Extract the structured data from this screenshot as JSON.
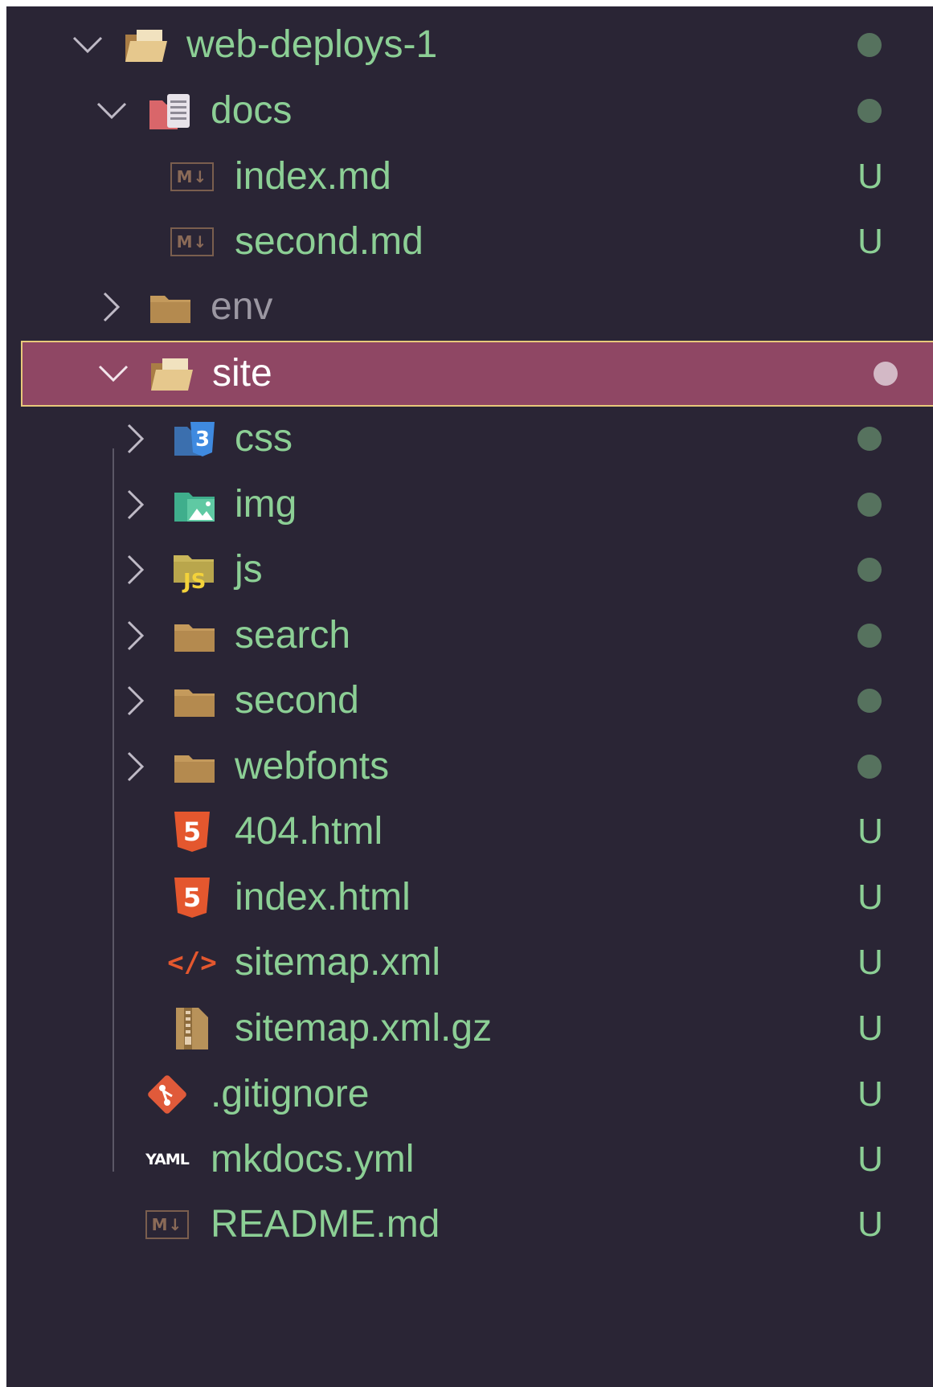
{
  "tree": {
    "root": {
      "label": "web-deploys-1",
      "icon": "folder-open-icon",
      "status": "dot"
    },
    "docs": {
      "label": "docs",
      "icon": "docs-folder-icon",
      "status": "dot"
    },
    "docs_index": {
      "label": "index.md",
      "icon": "markdown-icon",
      "status": "U"
    },
    "docs_second": {
      "label": "second.md",
      "icon": "markdown-icon",
      "status": "U"
    },
    "env": {
      "label": "env",
      "icon": "folder-icon",
      "status": ""
    },
    "site": {
      "label": "site",
      "icon": "folder-open-icon",
      "status": "dot",
      "selected": true
    },
    "css": {
      "label": "css",
      "icon": "css-folder-icon",
      "status": "dot"
    },
    "img": {
      "label": "img",
      "icon": "image-folder-icon",
      "status": "dot"
    },
    "js": {
      "label": "js",
      "icon": "js-folder-icon",
      "status": "dot",
      "badge": "JS"
    },
    "search": {
      "label": "search",
      "icon": "folder-icon",
      "status": "dot"
    },
    "second": {
      "label": "second",
      "icon": "folder-icon",
      "status": "dot"
    },
    "webfonts": {
      "label": "webfonts",
      "icon": "folder-icon",
      "status": "dot"
    },
    "html404": {
      "label": "404.html",
      "icon": "html5-icon",
      "status": "U"
    },
    "index_html": {
      "label": "index.html",
      "icon": "html5-icon",
      "status": "U"
    },
    "sitemap_xml": {
      "label": "sitemap.xml",
      "icon": "xml-icon",
      "status": "U"
    },
    "sitemap_gz": {
      "label": "sitemap.xml.gz",
      "icon": "zip-icon",
      "status": "U"
    },
    "gitignore": {
      "label": ".gitignore",
      "icon": "git-icon",
      "status": "U"
    },
    "mkdocs": {
      "label": "mkdocs.yml",
      "icon": "yaml-icon",
      "status": "U"
    },
    "readme": {
      "label": "README.md",
      "icon": "markdown-icon",
      "status": "U"
    }
  },
  "icon_glyphs": {
    "md_badge": "M↓",
    "yaml_badge": "YAML",
    "css_badge": "3",
    "html_badge": "5",
    "xml_glyph": "</>"
  },
  "colors": {
    "background": "#2a2535",
    "text_untracked": "#8ccf95",
    "text_ignored": "#9b97a2",
    "selected_bg": "#8f4764",
    "selected_border": "#e8c97a",
    "folder": "#c49a5c",
    "html": "#e4572e",
    "css": "#3f7fd0",
    "git": "#e05a3a"
  }
}
